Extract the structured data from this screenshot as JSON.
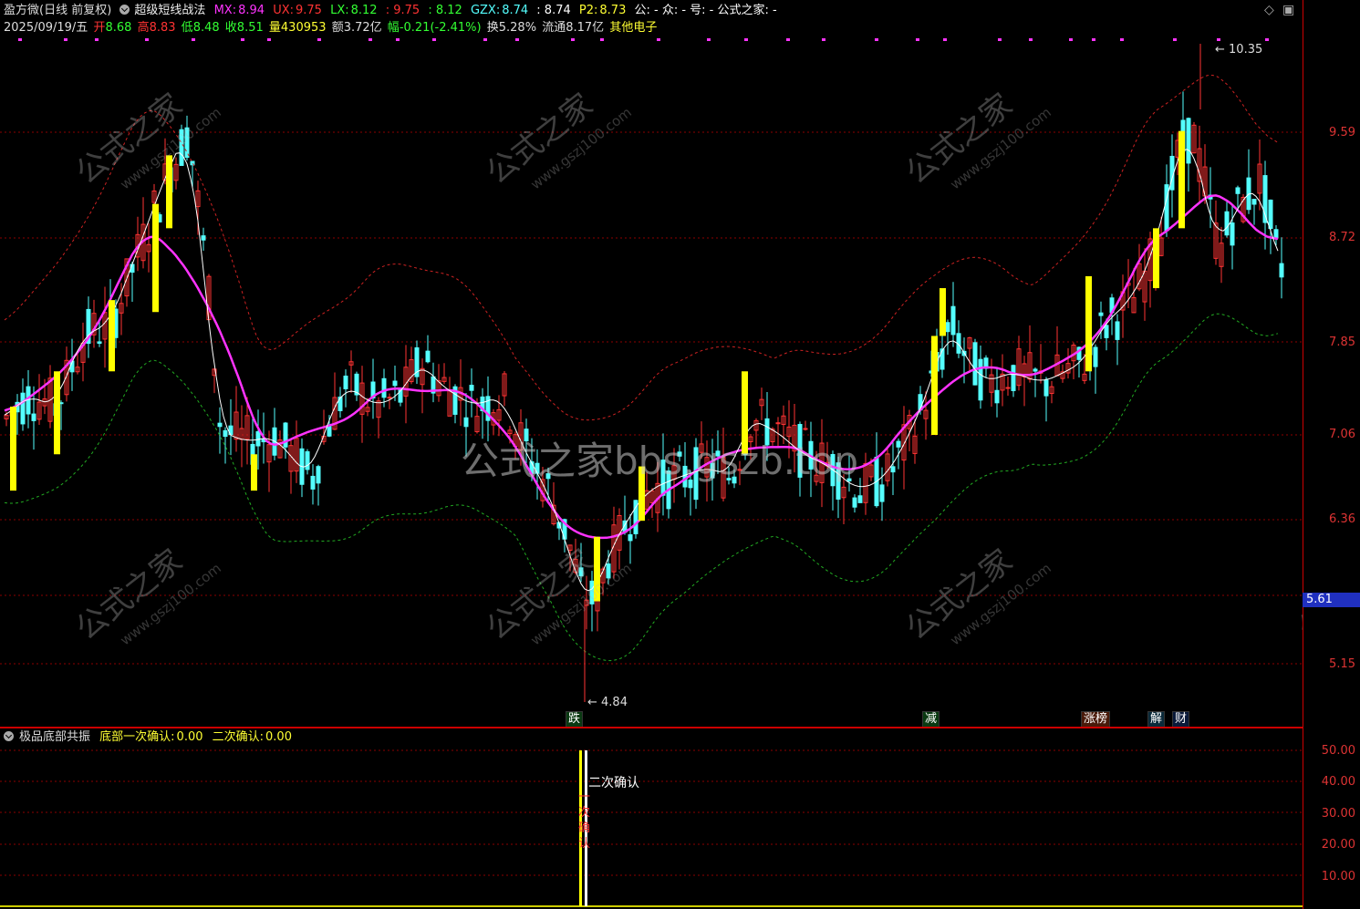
{
  "header": {
    "app_title": "盈方微(日线 前复权)",
    "indicator_name": "超级短线战法",
    "mx_label": "MX:",
    "mx_value": "8.94",
    "ux_label": "UX:",
    "ux_value": "9.75",
    "lx_label": "LX:",
    "lx_value": "8.12",
    "c1": ": 9.75",
    "c2": ": 8.12",
    "gzx_label": "GZX:",
    "gzx_value": "8.74",
    "c3": ": 8.74",
    "p2_label": "P2:",
    "p2_value": "8.73",
    "gzh": "公: - 众: - 号: - 公式之家: -"
  },
  "quote": {
    "date": "2025/09/19/五",
    "open_label": "开",
    "open": "8.68",
    "high_label": "高",
    "high": "8.83",
    "low_label": "低",
    "low": "8.48",
    "close_label": "收",
    "close": "8.51",
    "vol_label": "量",
    "vol": "430953",
    "amt_label": "额",
    "amt": "3.72亿",
    "chg_label": "幅",
    "chg": "-0.21(-2.41%)",
    "turn_label": "换",
    "turn": "5.28%",
    "float_label": "流通",
    "float": "8.17亿",
    "sector": "其他电子"
  },
  "price_axis": [
    "9.59",
    "8.72",
    "7.85",
    "7.06",
    "6.36",
    "5.15"
  ],
  "current_price": "5.61",
  "high_marker": "10.35",
  "low_marker": "4.84",
  "events": [
    {
      "label": "跌",
      "color": "#1a8a2a"
    },
    {
      "label": "减",
      "color": "#1a8a2a"
    },
    {
      "label": "涨榜",
      "color": "#c05020"
    },
    {
      "label": "解",
      "color": "#2080a0"
    },
    {
      "label": "财",
      "color": "#2060c0"
    }
  ],
  "watermark": "公式之家bbs.gszb.top",
  "watermark_small": "公式之家",
  "watermark_url": "www.gszj100.com",
  "sub": {
    "name": "极品底部共振",
    "first_label": "底部一次确认:",
    "first_value": "0.00",
    "second_label": "二次确认:",
    "second_value": "0.00",
    "annot": "二次确认",
    "annot2": "一次确认",
    "axis": [
      "50.00",
      "40.00",
      "30.00",
      "20.00",
      "10.00"
    ]
  },
  "colors": {
    "bg": "#000000",
    "up": "#ff3333",
    "down": "#54ffff",
    "ma": "#ff33ff",
    "signal": "#ffff00",
    "upper": "#cc2222",
    "lower": "#22aa22",
    "grid": "#8b0000"
  }
}
